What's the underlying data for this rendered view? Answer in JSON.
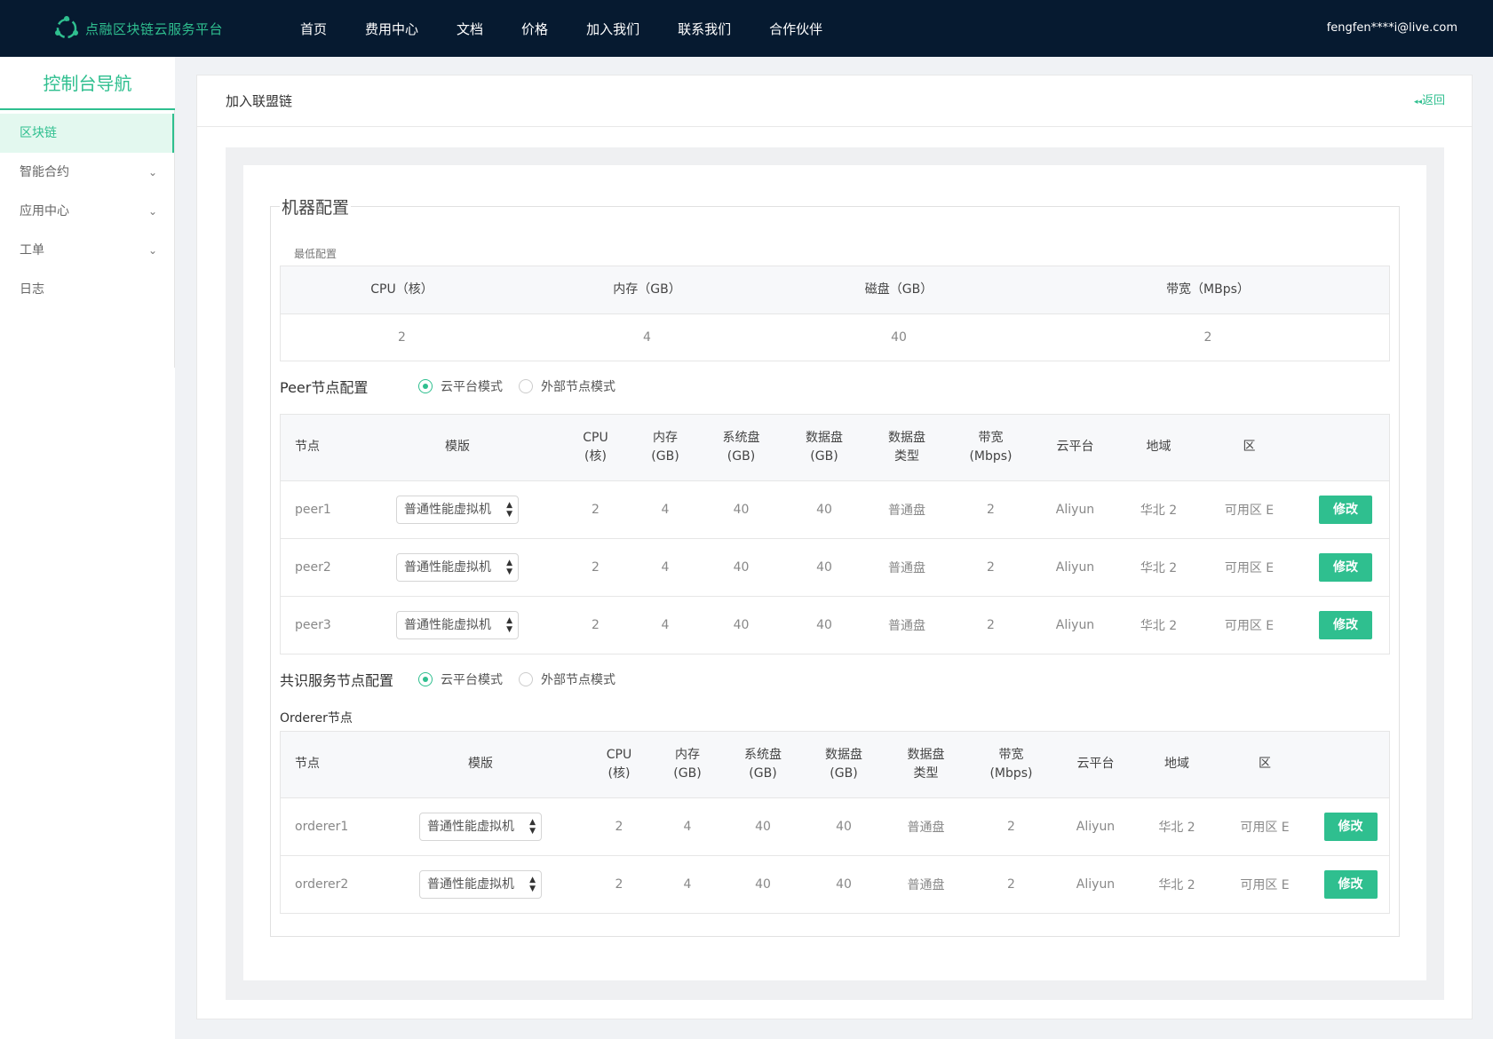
{
  "header": {
    "logo_text": "点融区块链云服务平台",
    "nav": [
      "首页",
      "费用中心",
      "文档",
      "价格",
      "加入我们",
      "联系我们",
      "合作伙伴"
    ],
    "user_email": "fengfen****i@live.com"
  },
  "sidebar": {
    "title": "控制台导航",
    "items": [
      {
        "label": "区块链",
        "active": true
      },
      {
        "label": "智能合约",
        "arrow": "⌄"
      },
      {
        "label": "应用中心",
        "arrow": "⌄"
      },
      {
        "label": "工单",
        "arrow": "⌄"
      },
      {
        "label": "日志"
      }
    ]
  },
  "page": {
    "title": "加入联盟链",
    "back_label": "返回",
    "back_icon": "◂◂"
  },
  "machine_config": {
    "legend": "机器配置",
    "min_label": "最低配置",
    "min_headers": [
      "CPU（核）",
      "内存（GB）",
      "磁盘（GB）",
      "带宽（MBps）"
    ],
    "min_values": [
      "2",
      "4",
      "40",
      "2"
    ]
  },
  "peer": {
    "title": "Peer节点配置",
    "mode_cloud": "云平台模式",
    "mode_external": "外部节点模式",
    "headers": [
      "节点",
      "模版",
      "CPU\n(核)",
      "内存\n(GB)",
      "系统盘\n(GB)",
      "数据盘\n(GB)",
      "数据盘\n类型",
      "带宽\n(Mbps)",
      "云平台",
      "地域",
      "区"
    ],
    "rows": [
      {
        "node": "peer1",
        "template": "普通性能虚拟机",
        "cpu": "2",
        "mem": "4",
        "sys": "40",
        "data": "40",
        "type": "普通盘",
        "bw": "2",
        "cloud": "Aliyun",
        "region": "华北 2",
        "zone": "可用区 E",
        "action": "修改"
      },
      {
        "node": "peer2",
        "template": "普通性能虚拟机",
        "cpu": "2",
        "mem": "4",
        "sys": "40",
        "data": "40",
        "type": "普通盘",
        "bw": "2",
        "cloud": "Aliyun",
        "region": "华北 2",
        "zone": "可用区 E",
        "action": "修改"
      },
      {
        "node": "peer3",
        "template": "普通性能虚拟机",
        "cpu": "2",
        "mem": "4",
        "sys": "40",
        "data": "40",
        "type": "普通盘",
        "bw": "2",
        "cloud": "Aliyun",
        "region": "华北 2",
        "zone": "可用区 E",
        "action": "修改"
      }
    ]
  },
  "orderer": {
    "title": "共识服务节点配置",
    "mode_cloud": "云平台模式",
    "mode_external": "外部节点模式",
    "sub_label": "Orderer节点",
    "headers": [
      "节点",
      "模版",
      "CPU\n(核)",
      "内存\n(GB)",
      "系统盘\n(GB)",
      "数据盘\n(GB)",
      "数据盘\n类型",
      "带宽\n(Mbps)",
      "云平台",
      "地域",
      "区"
    ],
    "rows": [
      {
        "node": "orderer1",
        "template": "普通性能虚拟机",
        "cpu": "2",
        "mem": "4",
        "sys": "40",
        "data": "40",
        "type": "普通盘",
        "bw": "2",
        "cloud": "Aliyun",
        "region": "华北 2",
        "zone": "可用区 E",
        "action": "修改"
      },
      {
        "node": "orderer2",
        "template": "普通性能虚拟机",
        "cpu": "2",
        "mem": "4",
        "sys": "40",
        "data": "40",
        "type": "普通盘",
        "bw": "2",
        "cloud": "Aliyun",
        "region": "华北 2",
        "zone": "可用区 E",
        "action": "修改"
      }
    ]
  },
  "colors": {
    "accent": "#2fbf8f",
    "topbar": "#061a30"
  }
}
